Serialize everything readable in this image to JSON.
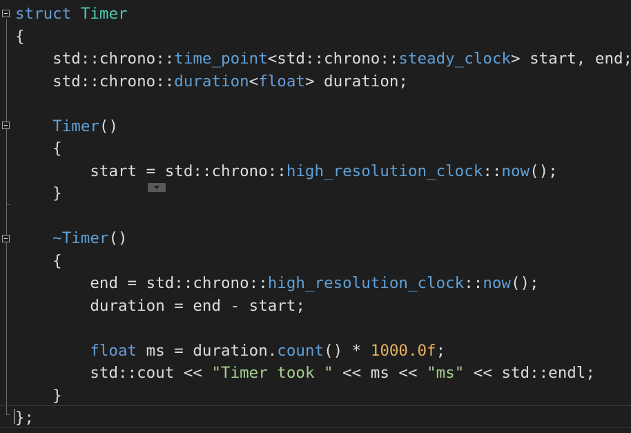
{
  "editor": {
    "language": "cpp",
    "colors": {
      "background": "#1e1e1e",
      "keyword": "#6a9ad8",
      "identifier": "#dcdcdc",
      "string": "#d69d85",
      "number": "#e8b060"
    },
    "lines": [
      {
        "tokens": [
          [
            "kw",
            "struct"
          ],
          [
            "plain",
            " "
          ],
          [
            "ty",
            "Timer"
          ]
        ]
      },
      {
        "tokens": [
          [
            "plain",
            "{"
          ]
        ]
      },
      {
        "tokens": [
          [
            "plain",
            "    std::chrono::"
          ],
          [
            "typ",
            "time_point"
          ],
          [
            "plain",
            "<std::chrono::"
          ],
          [
            "typ",
            "steady_clock"
          ],
          [
            "plain",
            "> start, end;"
          ]
        ]
      },
      {
        "tokens": [
          [
            "plain",
            "    std::chrono::"
          ],
          [
            "typ",
            "duration"
          ],
          [
            "plain",
            "<"
          ],
          [
            "kw",
            "float"
          ],
          [
            "plain",
            "> duration;"
          ]
        ]
      },
      {
        "tokens": []
      },
      {
        "tokens": [
          [
            "plain",
            "    "
          ],
          [
            "typ",
            "Timer"
          ],
          [
            "plain",
            "()"
          ]
        ]
      },
      {
        "tokens": [
          [
            "plain",
            "    {"
          ]
        ]
      },
      {
        "tokens": [
          [
            "plain",
            "        start = std::chrono::"
          ],
          [
            "typ",
            "high_resolution_clock"
          ],
          [
            "plain",
            "::"
          ],
          [
            "typ",
            "now"
          ],
          [
            "plain",
            "();"
          ]
        ]
      },
      {
        "tokens": [
          [
            "plain",
            "    }"
          ]
        ]
      },
      {
        "tokens": []
      },
      {
        "tokens": [
          [
            "plain",
            "    "
          ],
          [
            "typ",
            "~Timer"
          ],
          [
            "plain",
            "()"
          ]
        ]
      },
      {
        "tokens": [
          [
            "plain",
            "    {"
          ]
        ]
      },
      {
        "tokens": [
          [
            "plain",
            "        end = std::chrono::"
          ],
          [
            "typ",
            "high_resolution_clock"
          ],
          [
            "plain",
            "::"
          ],
          [
            "typ",
            "now"
          ],
          [
            "plain",
            "();"
          ]
        ]
      },
      {
        "tokens": [
          [
            "plain",
            "        duration = end - start;"
          ]
        ]
      },
      {
        "tokens": []
      },
      {
        "tokens": [
          [
            "plain",
            "        "
          ],
          [
            "kw",
            "float"
          ],
          [
            "plain",
            " ms = duration."
          ],
          [
            "typ",
            "count"
          ],
          [
            "plain",
            "() * "
          ],
          [
            "num",
            "1000.0f"
          ],
          [
            "plain",
            ";"
          ]
        ]
      },
      {
        "tokens": [
          [
            "plain",
            "        std::cout << "
          ],
          [
            "str-g",
            "\"Timer took \""
          ],
          [
            "plain",
            " << ms << "
          ],
          [
            "str-g",
            "\"ms\""
          ],
          [
            "plain",
            " << std::endl;"
          ]
        ]
      },
      {
        "tokens": [
          [
            "plain",
            "    }"
          ]
        ]
      },
      {
        "tokens": [
          [
            "plain",
            "};"
          ]
        ]
      }
    ]
  }
}
